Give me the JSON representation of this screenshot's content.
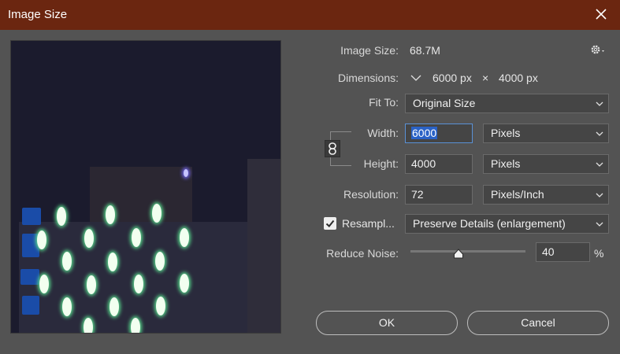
{
  "window": {
    "title": "Image Size",
    "close_icon": "close-icon"
  },
  "info": {
    "image_size_label": "Image Size:",
    "image_size_value": "68.7M",
    "dimensions_label": "Dimensions:",
    "dim_width": "6000 px",
    "dim_times": "×",
    "dim_height": "4000 px"
  },
  "fit_to": {
    "label": "Fit To:",
    "value": "Original Size"
  },
  "width": {
    "label": "Width:",
    "value": "6000",
    "unit": "Pixels"
  },
  "height": {
    "label": "Height:",
    "value": "4000",
    "unit": "Pixels"
  },
  "resolution": {
    "label": "Resolution:",
    "value": "72",
    "unit": "Pixels/Inch"
  },
  "resample": {
    "label": "Resampl...",
    "checked": true,
    "method": "Preserve Details (enlargement)"
  },
  "reduce_noise": {
    "label": "Reduce Noise:",
    "value": "40",
    "unit": "%",
    "level_percent": 40
  },
  "buttons": {
    "ok": "OK",
    "cancel": "Cancel"
  },
  "colors": {
    "titlebar": "#6b2610",
    "dialog_bg": "#535353",
    "selection": "#2a62c6",
    "focus_border": "#5a91d6"
  }
}
